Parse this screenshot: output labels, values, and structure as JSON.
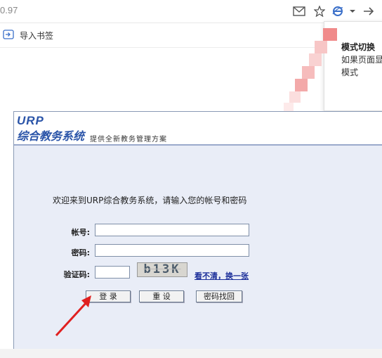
{
  "browser": {
    "url_fragment": "0.97",
    "bookmark_label": "导入书签",
    "icons": [
      "mail-icon",
      "star-icon",
      "ie-mode-icon",
      "chevron-down-icon",
      "forward-arrow-icon"
    ]
  },
  "popup": {
    "title": "模式切换",
    "line1": "如果页面显",
    "line2": "模式"
  },
  "urp": {
    "logo_top": "URP",
    "logo_bottom": "综合教务系统",
    "subtitle": "提供全新教务管理方案",
    "welcome": "欢迎来到URP综合教务系统，请输入您的帐号和密码",
    "form": {
      "account_label": "帐号:",
      "password_label": "密码:",
      "captcha_label": "验证码:",
      "captcha_text": "b13K",
      "refresh_link": "看不清，换一张"
    },
    "buttons": {
      "login": "登 录",
      "reset": "重 设",
      "recover": "密码找回"
    }
  },
  "colors": {
    "urp_blue": "#2a54a8",
    "page_bg": "#e9edf7",
    "arrow_red": "#e02020",
    "link_blue": "#1c2f9a"
  }
}
